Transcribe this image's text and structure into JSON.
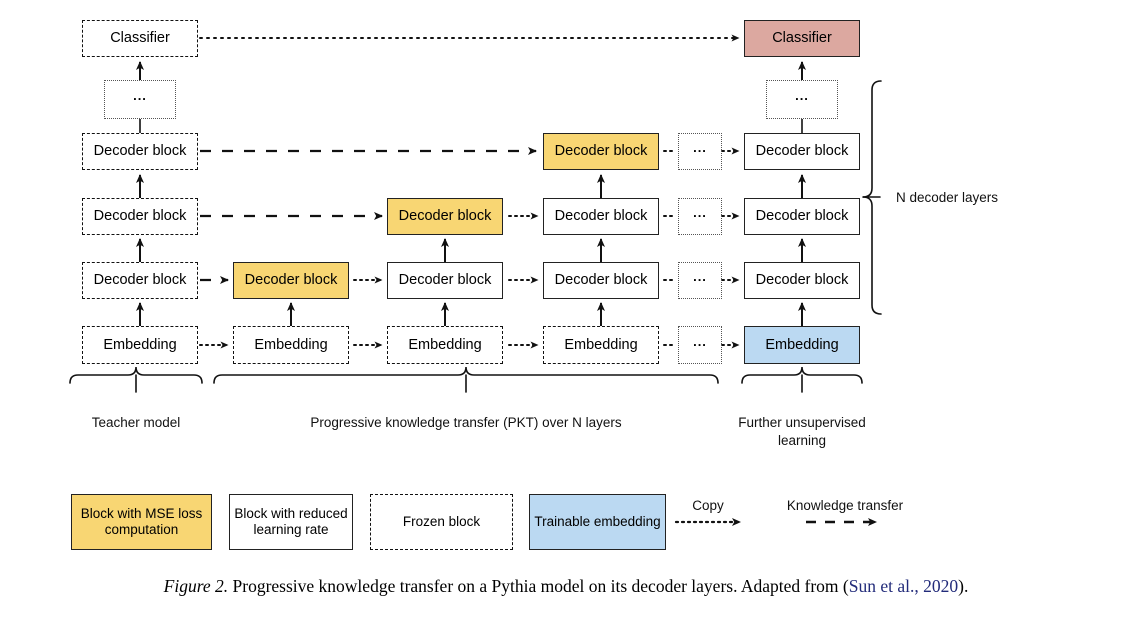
{
  "figure": {
    "caption_label": "Figure 2.",
    "caption_text": " Progressive knowledge transfer on a Pythia model on its decoder layers. Adapted from (",
    "caption_citation": "Sun et al., 2020",
    "caption_end": ").",
    "colors": {
      "mse_block": "#F8D673",
      "trainable_embedding": "#BBD9F2",
      "classifier": "#DCA8A0",
      "reduced_lr_block": "#FFFFFF",
      "outline": "#222222",
      "citation": "#222b7a"
    }
  },
  "labels": {
    "classifier": "Classifier",
    "decoder_block": "Decoder block",
    "embedding": "Embedding",
    "ellipsis": "..."
  },
  "columns": {
    "teacher": {
      "classifier": "Classifier",
      "ellipsis": "...",
      "decoder_3": "Decoder block",
      "decoder_2": "Decoder block",
      "decoder_1": "Decoder block",
      "embedding": "Embedding"
    },
    "step1": {
      "decoder_1": "Decoder block",
      "embedding": "Embedding"
    },
    "step2": {
      "decoder_2": "Decoder block",
      "decoder_1": "Decoder block",
      "embedding": "Embedding"
    },
    "step3": {
      "decoder_3": "Decoder block",
      "decoder_2": "Decoder block",
      "decoder_1": "Decoder block",
      "embedding": "Embedding"
    },
    "gap": {
      "decoder_3": "...",
      "decoder_2": "...",
      "decoder_1": "...",
      "embedding": "..."
    },
    "final": {
      "classifier": "Classifier",
      "ellipsis": "...",
      "decoder_3": "Decoder block",
      "decoder_2": "Decoder block",
      "decoder_1": "Decoder block",
      "embedding": "Embedding"
    }
  },
  "braces": {
    "teacher": "Teacher model",
    "pkt": "Progressive knowledge transfer (PKT) over N layers",
    "further_line1": "Further unsupervised",
    "further_line2": "learning",
    "n_decoder_layers": "N decoder layers"
  },
  "legend": {
    "items": [
      {
        "line1": "Block with MSE loss",
        "line2": "computation",
        "style": "yellow"
      },
      {
        "line1": "Block with reduced",
        "line2": "learning rate",
        "style": "solid"
      },
      {
        "line1": "Frozen block",
        "line2": "",
        "style": "dashed"
      },
      {
        "line1": "Trainable embedding",
        "line2": "",
        "style": "blue"
      }
    ],
    "copy": "Copy",
    "knowledge_transfer": "Knowledge transfer"
  }
}
